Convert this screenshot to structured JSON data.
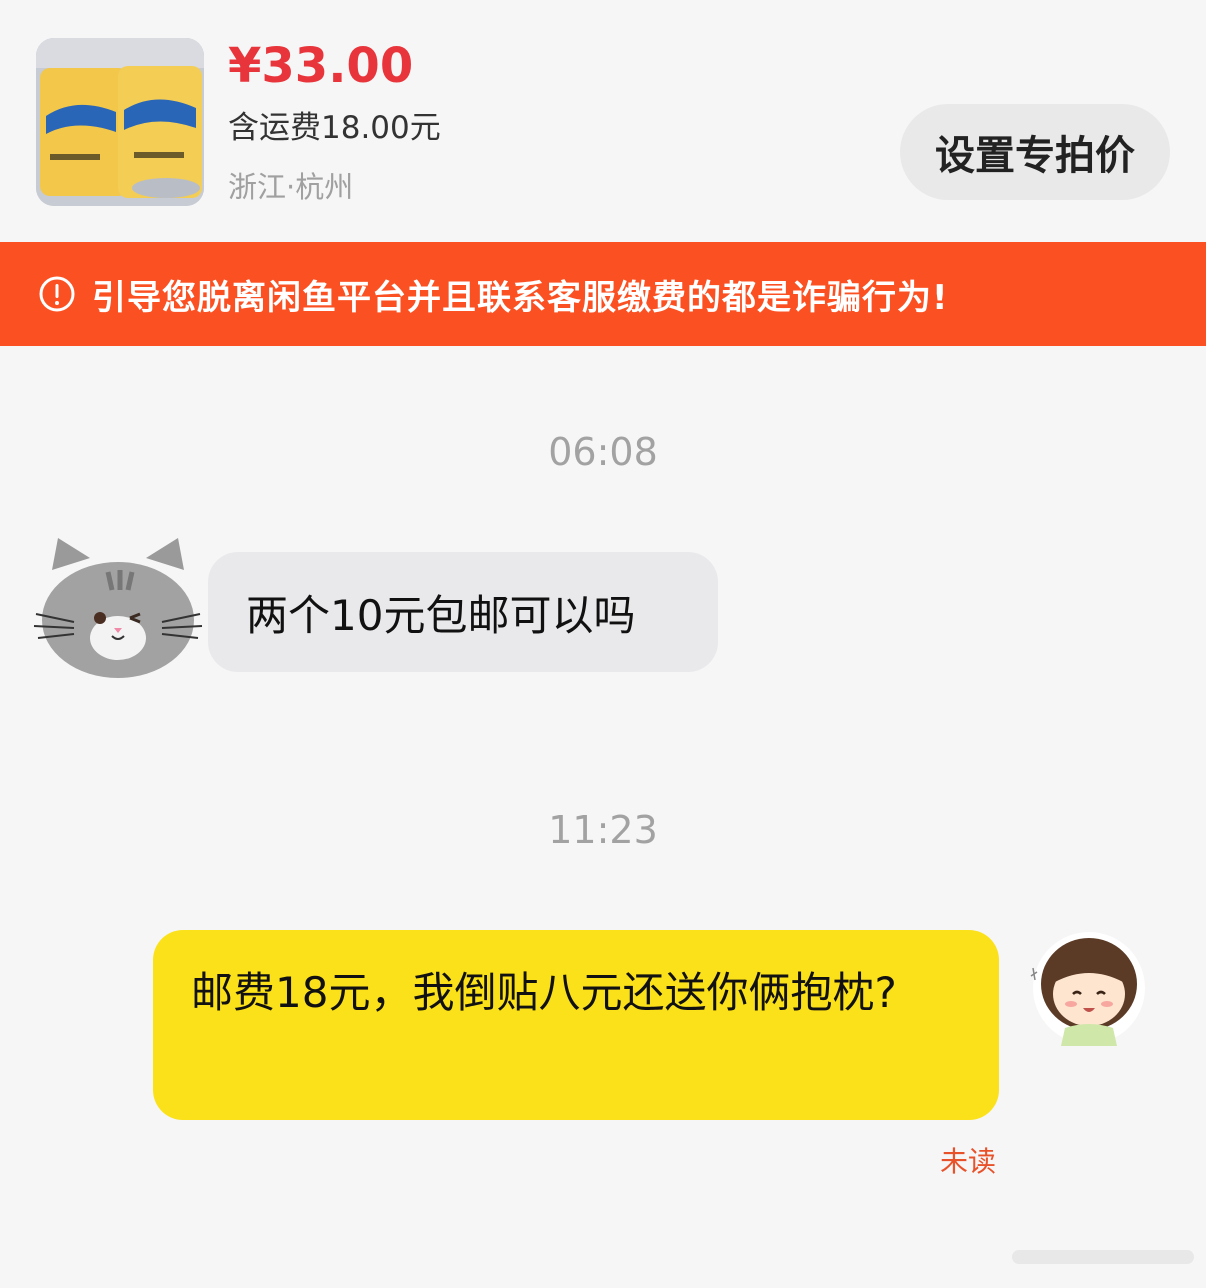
{
  "item": {
    "price": "¥33.00",
    "shipping": "含运费18.00元",
    "location": "浙江·杭州",
    "image_icon": "product-pillow-photo"
  },
  "actions": {
    "set_price_label": "设置专拍价"
  },
  "warning": {
    "icon": "exclamation-circle-icon",
    "text": "引导您脱离闲鱼平台并且联系客服缴费的都是诈骗行为!"
  },
  "chat": {
    "messages": [
      {
        "time": "06:08",
        "sender": "other",
        "avatar": "cat-avatar",
        "text": "两个10元包邮可以吗"
      },
      {
        "time": "11:23",
        "sender": "me",
        "avatar": "anime-girl-avatar",
        "text": "邮费18元，我倒贴八元还送你俩抱枕?",
        "status": "未读"
      }
    ]
  },
  "colors": {
    "price": "#e8353c",
    "warning_bg": "#fb5022",
    "bubble_other": "#e9e9ec",
    "bubble_me": "#fbe11a",
    "unread": "#e8522a"
  }
}
